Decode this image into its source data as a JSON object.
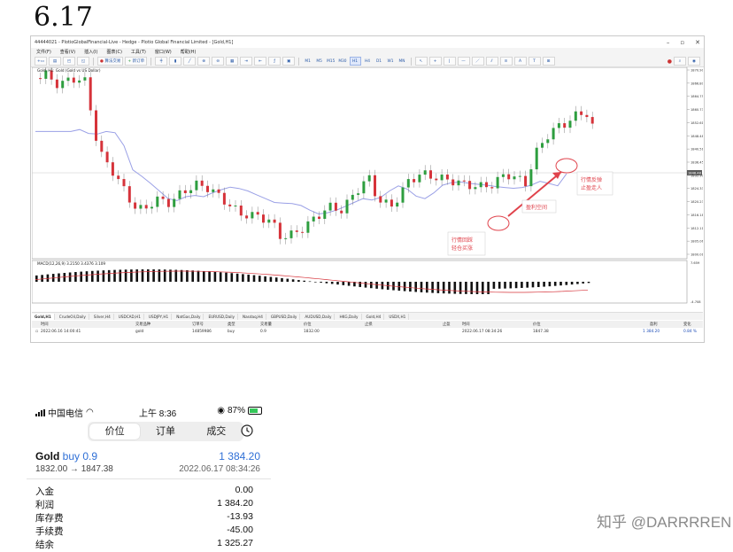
{
  "doc": {
    "title": "6.17"
  },
  "terminal": {
    "title": "44444021 - PlotioGlobalFinancial-Live - Hedge - Plotio Global Financial Limited - [Gold,H1]",
    "menu": [
      "文件(F)",
      "查看(V)",
      "插入(I)",
      "图表(C)",
      "工具(T)",
      "窗口(W)",
      "帮助(H)"
    ],
    "toolbar": {
      "new_order": "新订单",
      "auto_trading": "算法交易",
      "timeframes": [
        "M1",
        "M5",
        "M15",
        "M30",
        "H1",
        "H4",
        "D1",
        "W1",
        "MN"
      ]
    },
    "chart_label": "Gold, H1:  Gold (Gold vs US Dollar)",
    "macd_label": "MACD(12,26,9) 3.2150 3.4376 3.109",
    "annotations": {
      "a1": "行情回踩",
      "a1b": "轻仓买涨",
      "a2": "盈利空间",
      "a3": "行情反弹",
      "a3b": "止盈走人"
    },
    "symbol_tabs": [
      "Gold,H1",
      "CrudeOil,Daily",
      "Silver,H4",
      "USDCAD,H1",
      "USDJPY,H1",
      "NatGas,Daily",
      "EURUSD,Daily",
      "Nasdaq,H4",
      "GBPUSD,Daily",
      "AUDUSD,Daily",
      "HKG,Daily",
      "Gold,H4",
      "USDX,H1"
    ],
    "trade_headers": [
      "时间",
      "交易品种",
      "订单号",
      "类型",
      "交易量",
      "价位",
      "止损",
      "止盈",
      "时间",
      "价位",
      "盈利",
      "变化"
    ],
    "trade_row": [
      "2022.06.16 14:00:41",
      "gold",
      "14859986",
      "buy",
      "0.9",
      "1832.00",
      "",
      "",
      "2022.06.17 08:34:26",
      "1847.38",
      "1 384.20",
      "0.84 %"
    ]
  },
  "phone": {
    "status": {
      "carrier": "中国电信",
      "time": "上午 8:36",
      "battery": "87%"
    },
    "tabs": [
      "价位",
      "订单",
      "成交"
    ],
    "active_tab": "价位",
    "position": {
      "symbol": "Gold",
      "side": "buy 0.9",
      "profit": "1 384.20",
      "price": "1832.00 → 1847.38",
      "date": "2022.06.17 08:34:26"
    },
    "summary": [
      {
        "label": "入金",
        "value": "0.00"
      },
      {
        "label": "利润",
        "value": "1 384.20"
      },
      {
        "label": "库存费",
        "value": "-13.93"
      },
      {
        "label": "手续费",
        "value": "-45.00"
      },
      {
        "label": "结余",
        "value": "1 325.27"
      }
    ]
  },
  "watermark": "知乎 @DARRRREN",
  "colors": {
    "bull": "#2e9e3f",
    "bear": "#d6333a",
    "ma": "#9aa0e6",
    "macd_signal": "#d6333a",
    "annotation": "#e0434c",
    "accent": "#2f6fd6"
  },
  "chart_data": {
    "type": "candlestick",
    "price_ticks": [
      "1870.90",
      "1866.80",
      "1864.75",
      "1860.73",
      "1852.61",
      "1848.48",
      "1840.51",
      "1836.45",
      "1832.30",
      "1824.33",
      "1820.23",
      "1816.18",
      "1812.11",
      "1805.06",
      "1800.01"
    ],
    "current_price": "1848.48",
    "time_ticks": [
      "15 Jun 2022",
      "15 Jun 12:00",
      "15 Jun 17:00",
      "15 Jun 22:00",
      "16 Jun 03:00",
      "16 Jun 08:00",
      "16 Jun 13:00",
      "16 Jun 18:00",
      "16 Jun 23:00",
      "17 Jun 04:00",
      "17 Jun 09:00"
    ],
    "macd_ticks": [
      "7.659",
      "-4.708"
    ]
  }
}
